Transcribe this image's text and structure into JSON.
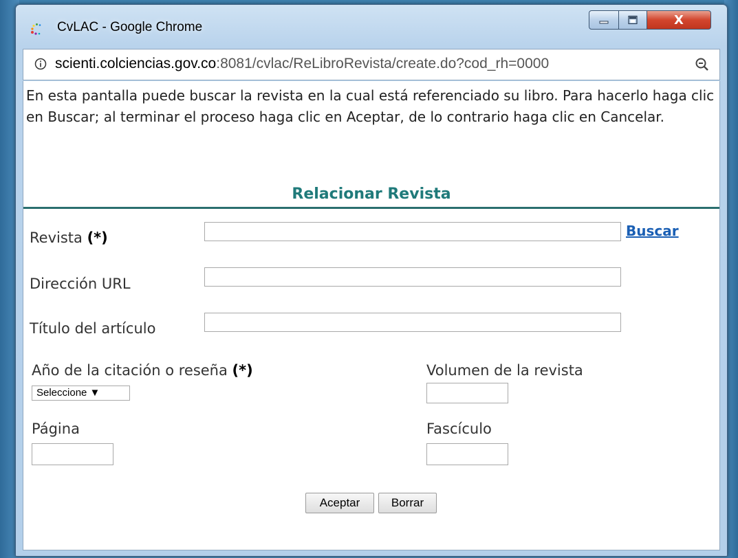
{
  "window": {
    "title": "CvLAC - Google Chrome",
    "close_glyph": "X"
  },
  "address": {
    "host": "scienti.colciencias.gov.co",
    "rest": ":8081/cvlac/ReLibroRevista/create.do?cod_rh=0000"
  },
  "intro_text": "En esta pantalla puede buscar la revista en la cual está referenciado su libro. Para hacerlo haga clic en Buscar; al terminar el proceso haga clic en Aceptar, de lo contrario haga clic en Cancelar.",
  "form": {
    "title": "Relacionar Revista",
    "revista_label": "Revista",
    "required_mark": "(*)",
    "buscar_link": "Buscar",
    "url_label": "Dirección URL",
    "titulo_label": "Título del artículo",
    "anio_label": "Año de la citación o reseña",
    "anio_select": "Seleccione ▼",
    "volumen_label": "Volumen de la revista",
    "pagina_label": "Página",
    "fasciculo_label": "Fascículo",
    "aceptar_button": "Aceptar",
    "borrar_button": "Borrar"
  },
  "colors": {
    "section_title": "#1f7a7a",
    "link": "#1a5fb4",
    "close_button": "#d2462e"
  }
}
